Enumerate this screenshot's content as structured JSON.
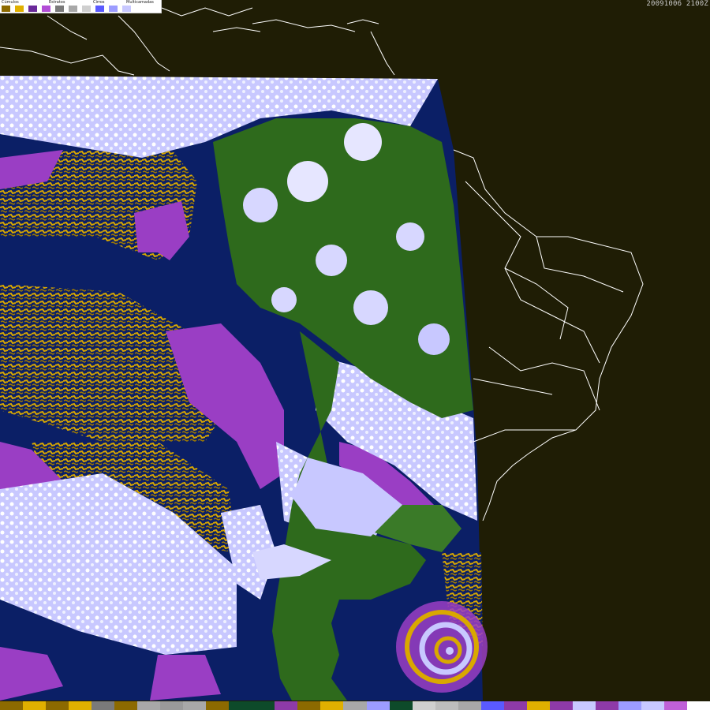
{
  "timestamp": "20091006 2100Z",
  "legend": {
    "labels": [
      "Cúmulos",
      "Estratos",
      "Cirros",
      "Multicamadas"
    ],
    "swatches": [
      "#8c6a00",
      "#e0b000",
      "#6a2a9a",
      "#b24dd6",
      "#7a7a7a",
      "#a8a8a8",
      "#cfcfcf",
      "#5a5aff",
      "#9c9cff",
      "#c8c8ff",
      "#ffffff",
      "#ffffff"
    ]
  },
  "bottom_bar_colors": [
    "#8c6a00",
    "#e0b000",
    "#8c6a00",
    "#e0b000",
    "#7a7a7a",
    "#8c6a00",
    "#a8a8a8",
    "#9a9a9a",
    "#a8a8a8",
    "#8c6a00",
    "#0d4a2a",
    "#0d4a2a",
    "#8e3aa8",
    "#8c6a00",
    "#e0b000",
    "#a8a8a8",
    "#9c9cff",
    "#0d4a2a",
    "#cfcfcf",
    "#bdbdbd",
    "#a8a8a8",
    "#5a5aff",
    "#8e3aa8",
    "#e0b000",
    "#8e3aa8",
    "#c8c8ff",
    "#8e3aa8",
    "#9c9cff",
    "#c8c8ff",
    "#c060d8",
    "#ffffff"
  ],
  "colors": {
    "background": "#1f1d05",
    "ocean": "#0b1f66",
    "land": "#2e6a1c",
    "cumulus": "#d9a800",
    "stratus": "#9a3ec4",
    "cirrus": "#c8c8ff",
    "borders": "#ffffff"
  }
}
